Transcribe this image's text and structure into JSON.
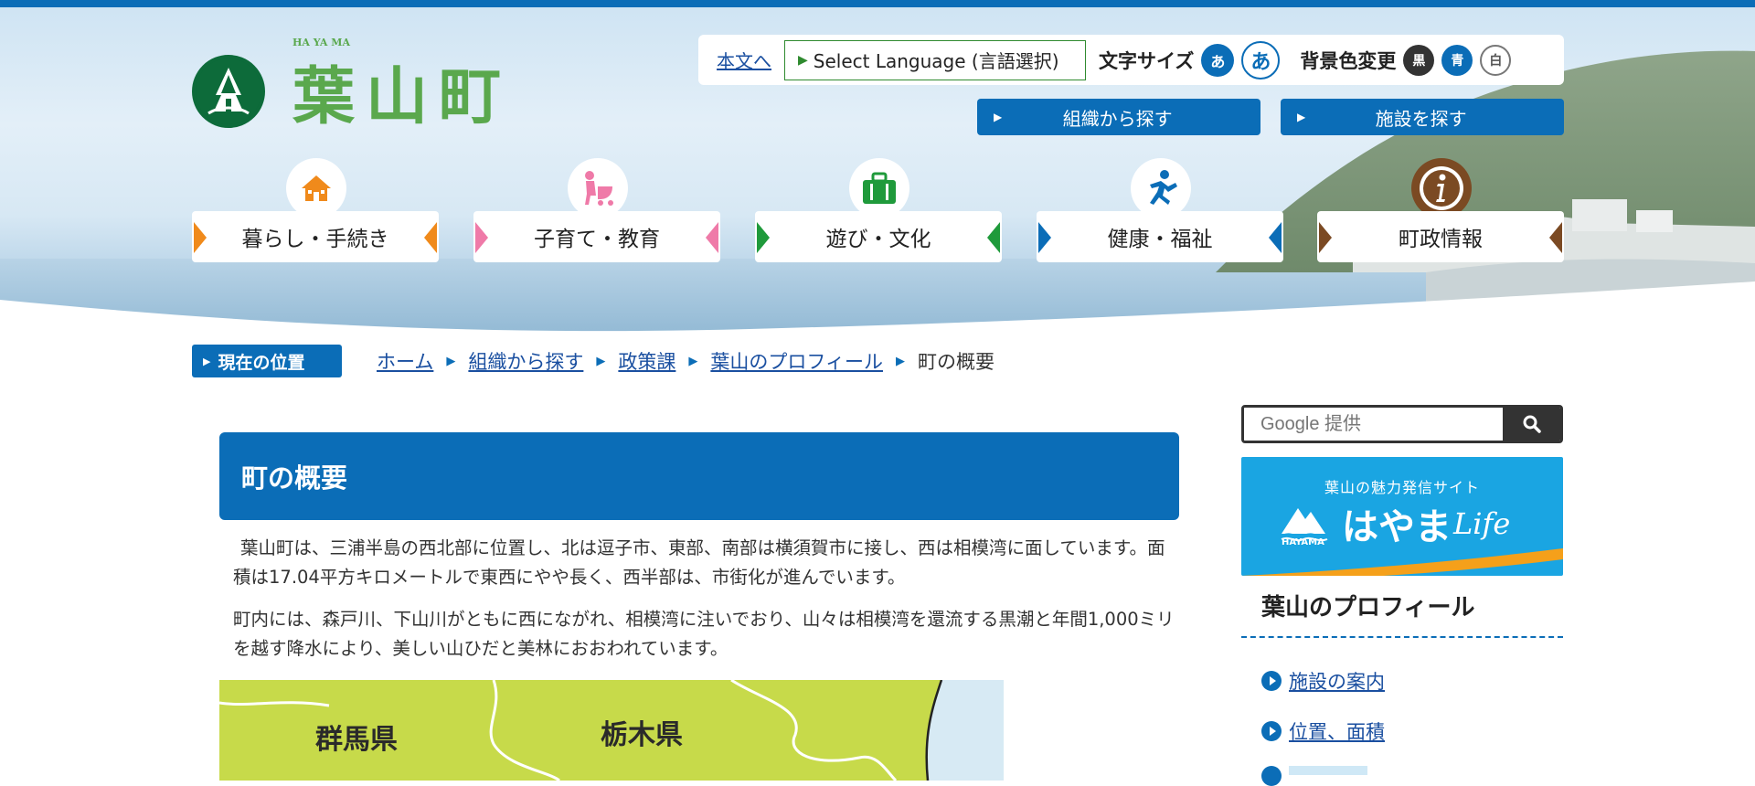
{
  "header": {
    "logo_text": "葉山町",
    "logo_romaji": "HA YA MA"
  },
  "utility": {
    "skip_link": "本文へ",
    "language": "Select Language (言語選択)",
    "font_size_label": "文字サイズ",
    "font_small": "あ",
    "font_large": "あ",
    "bg_color_label": "背景色変更",
    "bg_black": "黒",
    "bg_blue": "青",
    "bg_white": "白"
  },
  "find_buttons": {
    "by_org": "組織から探す",
    "by_facility": "施設を探す"
  },
  "global_nav": [
    {
      "label": "暮らし・手続き",
      "icon": "house-icon",
      "color": "#f08a1b"
    },
    {
      "label": "子育て・教育",
      "icon": "stroller-icon",
      "color": "#ef7aa8"
    },
    {
      "label": "遊び・文化",
      "icon": "suitcase-icon",
      "color": "#1f9a3b"
    },
    {
      "label": "健康・福祉",
      "icon": "runner-icon",
      "color": "#0b6db7"
    },
    {
      "label": "町政情報",
      "icon": "info-icon",
      "color": "#7b4a23"
    }
  ],
  "breadcrumb": {
    "label": "現在の位置",
    "items": [
      "ホーム",
      "組織から探す",
      "政策課",
      "葉山のプロフィール"
    ],
    "current": "町の概要"
  },
  "main": {
    "title": "町の概要",
    "paragraph1": "葉山町は、三浦半島の西北部に位置し、北は逗子市、東部、南部は横須賀市に接し、西は相模湾に面しています。面積は17.04平方キロメートルで東西にやや長く、西半部は、市街化が進んでいます。",
    "paragraph2": "町内には、森戸川、下山川がともに西にながれ、相模湾に注いでおり、山々は相模湾を還流する黒潮と年間1,000ミリを越す降水により、美しい山ひだと美林におおわれています。",
    "map_labels": [
      "群馬県",
      "栃木県"
    ]
  },
  "sidebar": {
    "search_placeholder": "Google 提供",
    "banner_sub": "葉山の魅力発信サイト",
    "banner_main": "はやま",
    "banner_life": "Life",
    "banner_hayama": "HAYAMA",
    "section_title": "葉山のプロフィール",
    "links": [
      "施設の案内",
      "位置、面積"
    ]
  },
  "colors": {
    "primary": "#0b6db7",
    "link": "#1a4fa0",
    "logo_green": "#5aa84d"
  }
}
